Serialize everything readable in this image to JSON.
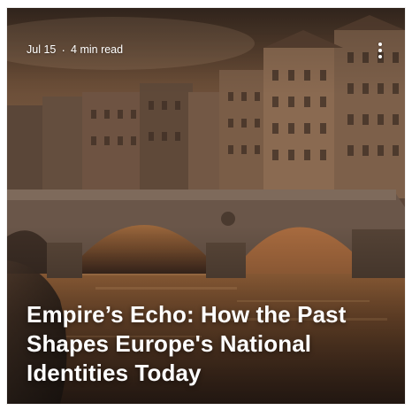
{
  "card": {
    "date": "Jul 15",
    "separator": "·",
    "read_time": "4 min read",
    "title": "Empire’s Echo: How the Past Shapes Europe's National Identities Today",
    "menu_icon": "more-vertical-icon"
  },
  "colors": {
    "sky": "#5e4533",
    "river": "#a86b3f",
    "bridge": "#6a5649",
    "text": "#ffffff"
  }
}
